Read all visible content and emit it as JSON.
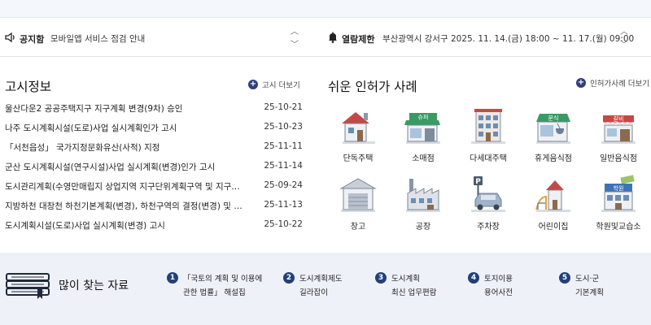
{
  "notice_bar": {
    "notice": {
      "label": "공지함",
      "text": "모바일앱 서비스 점검 안내"
    },
    "reading_room": {
      "label": "열람제한",
      "text": "부산광역시 강서구 2025. 11. 14.(금) 18:00 ~ 11. 17.(월) 09:00"
    }
  },
  "announcements": {
    "title": "고시정보",
    "more_label": "고시 더보기",
    "items": [
      {
        "title": "울산다운2 공공주택지구 지구계획 변경(9차) 승인",
        "date": "25-10-21"
      },
      {
        "title": "나주 도시계획시설(도로)사업 실시계획인가 고시",
        "date": "25-10-23"
      },
      {
        "title": "「서천읍성」 국가지정문화유산(사적) 지정",
        "date": "25-11-11"
      },
      {
        "title": "군산 도시계획시설(연구시설)사업 실시계획(변경)인가 고시",
        "date": "25-11-14"
      },
      {
        "title": "도시관리계획(수영만매립지 상업지역 지구단위계획구역 및 지구단위계획 결정)",
        "date": "25-09-24"
      },
      {
        "title": "지방하천 대창천 하천기본계획(변경), 하천구역의 결정(변경) 및 지형도면 고시",
        "date": "25-11-13"
      },
      {
        "title": "도시계획시설(도로)사업 실시계획(변경) 고시",
        "date": "25-10-22"
      }
    ]
  },
  "permit_cases": {
    "title": "쉬운 인허가 사례",
    "more_label": "인허가사례 더보기",
    "items": [
      {
        "label": "단독주택",
        "icon": "detached-house-icon"
      },
      {
        "label": "소매점",
        "icon": "retail-store-icon",
        "sign": "슈퍼"
      },
      {
        "label": "다세대주택",
        "icon": "multi-family-house-icon"
      },
      {
        "label": "휴게음식점",
        "icon": "snack-bar-icon",
        "sign": "분식"
      },
      {
        "label": "일반음식점",
        "icon": "restaurant-icon",
        "sign": "갈비"
      },
      {
        "label": "창고",
        "icon": "warehouse-icon"
      },
      {
        "label": "공장",
        "icon": "factory-icon"
      },
      {
        "label": "주차장",
        "icon": "parking-lot-icon",
        "sign": "P"
      },
      {
        "label": "어린이집",
        "icon": "daycare-icon"
      },
      {
        "label": "학원및교습소",
        "icon": "academy-icon",
        "sign": "학원"
      }
    ]
  },
  "popular_resources": {
    "title": "많이 찾는 자료",
    "items": [
      {
        "num": "1",
        "line1": "「국토의 계획 및 이용에",
        "line2": "관한 법률」 해설집"
      },
      {
        "num": "2",
        "line1": "도시계획제도",
        "line2": "길라잡이"
      },
      {
        "num": "3",
        "line1": "도시계획",
        "line2": "최신 업무편람"
      },
      {
        "num": "4",
        "line1": "토지이용",
        "line2": "용어사전"
      },
      {
        "num": "5",
        "line1": "도시·군",
        "line2": "기본계획"
      }
    ]
  },
  "colors": {
    "accent": "#2f3f7f",
    "badge": "#22407a",
    "bottom_bg": "#eef2f8"
  }
}
